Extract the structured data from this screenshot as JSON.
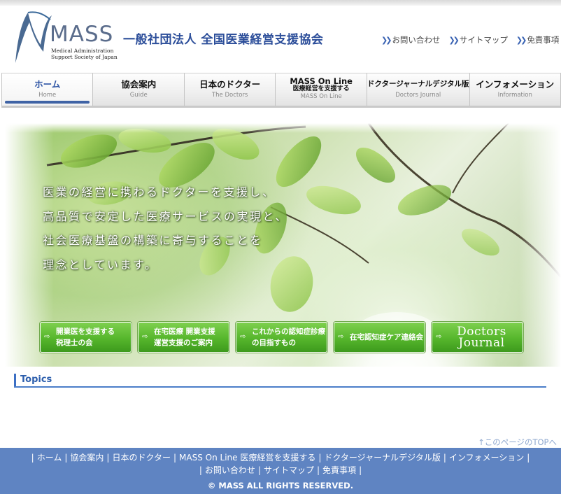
{
  "header": {
    "logo_word": "MASS",
    "logo_sub_1": "Medical Administration",
    "logo_sub_2": "Support Society of Japan",
    "org_name": "一般社団法人  全国医業経営支援協会",
    "util_links": [
      {
        "label": "お問い合わせ",
        "icon": "double-chevron-right-icon"
      },
      {
        "label": "サイトマップ",
        "icon": "double-chevron-right-icon"
      },
      {
        "label": "免責事項",
        "icon": "double-chevron-right-icon"
      }
    ]
  },
  "nav": {
    "items": [
      {
        "label": "ホーム",
        "sub": "Home",
        "active": true
      },
      {
        "label": "協会案内",
        "sub": "Guide"
      },
      {
        "label": "日本のドクター",
        "sub": "The Doctors"
      },
      {
        "label": "MASS On Line",
        "label2": "医療経営を支援する",
        "sub": "MASS On Line"
      },
      {
        "label": "ドクタージャーナルデジタル版",
        "sub": "Doctors Journal"
      },
      {
        "label": "インフォメーション",
        "sub": "Information"
      }
    ]
  },
  "hero": {
    "lines": [
      "医業の経営に携わるドクターを支援し、",
      "高品質で安定した医療サービスの実現と、",
      "社会医療基盤の構築に寄与することを",
      "理念としています。"
    ],
    "banners": [
      {
        "line1": "開業医を支援する",
        "line2": "税理士の会"
      },
      {
        "line1": "在宅医療 開業支援",
        "line2": "運営支援のご案内"
      },
      {
        "line1": "これからの認知症診療",
        "line2": "の目指すもの"
      },
      {
        "line1": "在宅認知症ケア連絡会",
        "line2": ""
      },
      {
        "line1": "Doctors",
        "line2": "Journal"
      }
    ]
  },
  "topics": {
    "title": "Topics"
  },
  "pagetop": "↑このページのTOPへ",
  "footer": {
    "links_row1": [
      "ホーム",
      "協会案内",
      "日本のドクター",
      "MASS On Line 医療経営を支援する",
      "ドクタージャーナルデジタル版",
      "インフォメーション"
    ],
    "links_row2": [
      "お問い合わせ",
      "サイトマップ",
      "免責事項"
    ],
    "separator": "|",
    "copyright": "© MASS ALL RIGHTS RESERVED."
  },
  "colors": {
    "brand_blue": "#2c4e9a",
    "footer_bg": "#5f84c2",
    "banner_green": "#56b62c",
    "nav_active": "#3f63a5"
  }
}
